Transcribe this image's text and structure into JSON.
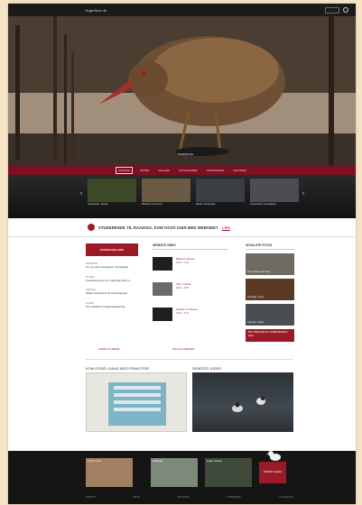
{
  "header": {
    "logo_text": "fuglefoto.dk",
    "search_label": "",
    "brand_color": "#7a1020"
  },
  "hero": {
    "caption": "VANDRIKSE"
  },
  "nav": {
    "items": [
      "FORSIDE",
      "ARTER",
      "GALLERI",
      "FOTOGRAFER",
      "AFSTEMNING",
      "OM SIDEN"
    ],
    "active_index": 0
  },
  "carousel": {
    "items": [
      {
        "caption": "Sortspætte i skoven"
      },
      {
        "caption": "Rørhøg over sivene"
      },
      {
        "caption": "Havørn ved kysten"
      },
      {
        "caption": "Knopsvane i solnedgang"
      }
    ]
  },
  "banner": {
    "text": "STUDERENDE TIL RAADIGA, KOM OGSÅ IGEN MED WEBSIDE?",
    "link": "LÆS"
  },
  "left_column": {
    "button": "DAGENS BILLEDE",
    "groups": [
      {
        "heading": "SENESTE",
        "text": "Tre nye arter fotograferet i Nordjylland"
      },
      {
        "heading": "NYHED",
        "text": "Fotokonkurrence for vinterfugle åben nu"
      },
      {
        "heading": "ARTIKEL",
        "text": "Sådan fotograferer du små sangfugle"
      },
      {
        "heading": "GUIDE",
        "text": "Nye objektiver til fuglefotografering"
      }
    ],
    "more": "FLERE NYHEDER"
  },
  "middle_column": {
    "heading": "SENESTE VIDEO",
    "videos": [
      {
        "title": "Blishøne på isen",
        "meta": "04.02 - 1:24"
      },
      {
        "title": "Vibe i marken",
        "meta": "02.02 - 0:58"
      },
      {
        "title": "Natugle om aftenen",
        "meta": "31.01 - 2:10"
      }
    ],
    "more": "SE ALLE VIDEOER"
  },
  "right_column": {
    "heading": "UDVALGTE FOTOS",
    "photos": [
      {
        "caption": "Hvid vipstjert ved søen"
      },
      {
        "caption": "Musvåge i træet"
      },
      {
        "caption": "Grå hejre i tågen"
      }
    ],
    "promo": "BLIV MEDLEM AF FORENINGEN I DAG"
  },
  "lower": {
    "left_heading": "KOM OGSÅ I GANG MED FRAKOTOR",
    "right_heading": "SENESTE VIDEO"
  },
  "footer": {
    "thumbs": [
      {
        "caption": "Fugle i haven"
      },
      {
        "caption": "Vadefugle"
      },
      {
        "caption": "Fugle i skoven"
      }
    ],
    "promo": "DANSK Spejlet",
    "links": [
      "KONTAKT",
      "OM OS",
      "ANNONCER",
      "NYHEDSBREV",
      "© FUGLEFOTO"
    ]
  }
}
